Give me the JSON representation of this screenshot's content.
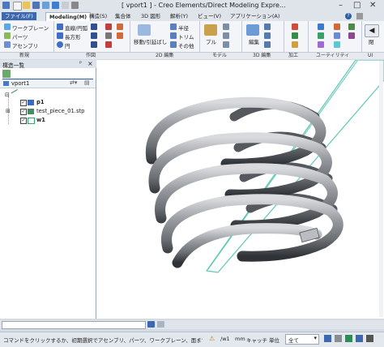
{
  "window": {
    "title": "[ vport1 ] - Creo Elements/Direct Modeling Expre...",
    "minimize": "–",
    "maximize": "□",
    "close": "✕",
    "help": "?"
  },
  "tabs": [
    "ファイル(F)",
    "Modeling(M)",
    "構造(S)",
    "集合体",
    "3D 図形",
    "解析(Y)",
    "ビュー(V)",
    "アプリケーション(A)"
  ],
  "ribbon": {
    "new_group": {
      "items": [
        "ワークプレーン",
        "パーツ",
        "アセンブリ"
      ],
      "label": "新規"
    },
    "create_group": {
      "items": [
        "直線/円弧",
        "長方形",
        "円"
      ],
      "label": "作図"
    },
    "edit2d_group": {
      "items": [
        "移動/引延ばし",
        "半径",
        "トリム",
        "その他"
      ],
      "label": "2D 編集"
    },
    "model_group": {
      "items": [
        "プル"
      ],
      "label": "モデル"
    },
    "edit3d_group": {
      "items": [
        "編集"
      ],
      "label": "3D 編集"
    },
    "machining_group": {
      "label": "加工"
    },
    "utility_group": {
      "label": "ユーティリティ"
    },
    "ui_group": {
      "items": [
        "閉"
      ],
      "label": "UI"
    }
  },
  "structure_panel": {
    "title": "構造一覧",
    "pin": "ᵖ",
    "close": "×",
    "viewport_name": "vport1",
    "items": [
      {
        "name": "p1",
        "bold": true
      },
      {
        "name": "test_piece_01.stp",
        "bold": false
      },
      {
        "name": "w1",
        "bold": true
      }
    ]
  },
  "command_line": {
    "placeholder": ""
  },
  "status": {
    "message": "コマンドをクリックするか、初期選択でアセンブリ、パーツ、ワークプレーン、面まで...",
    "path": "/w1",
    "unit_mm": "mm",
    "catch": "キャッチ",
    "unit": "単位",
    "filter": "全て"
  },
  "colors": {
    "accent": "#2b5ca8",
    "workplane": "#5cc7b4",
    "spring": "#8a8d92"
  }
}
